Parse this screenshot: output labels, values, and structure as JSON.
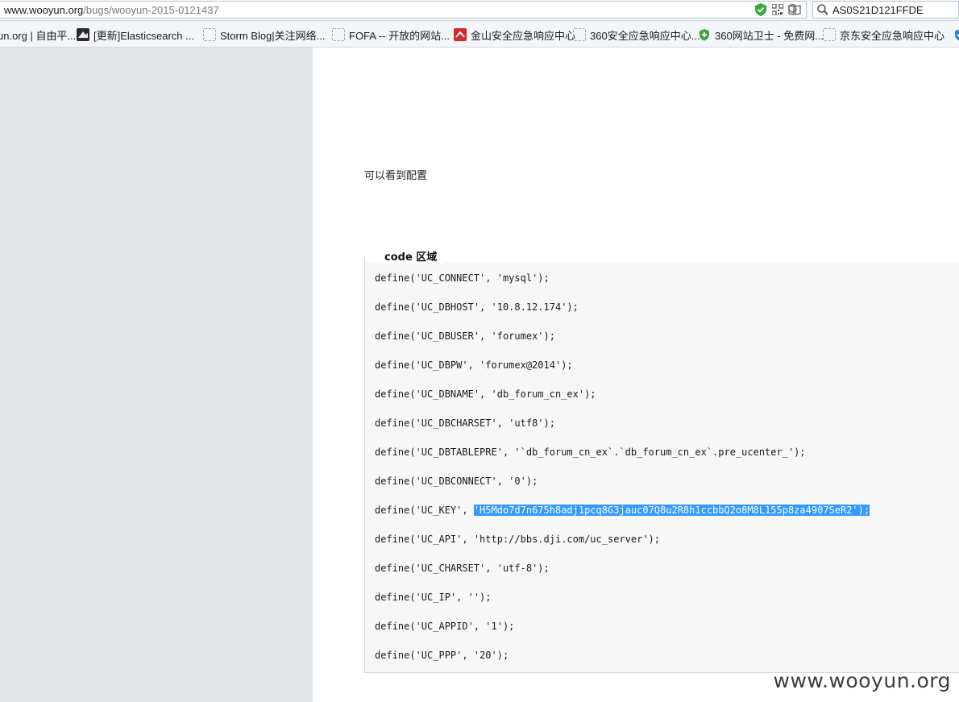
{
  "address_bar": {
    "url_domain": "www.wooyun.org",
    "url_path": "/bugs/wooyun-2015-0121437",
    "search_value": "AS0S21D121FFDE"
  },
  "icons": {
    "secure": "shield-check-icon",
    "qr": "qr-code-icon",
    "reader": "reader-mode-icon",
    "refresh": "refresh-icon",
    "search": "search-icon"
  },
  "bookmarks": [
    {
      "label": "un.org | 自由平...",
      "icon": "none"
    },
    {
      "label": "[更新]Elasticsearch ...",
      "icon": "dark"
    },
    {
      "label": "Storm Blog|关注网络...",
      "icon": "dotted"
    },
    {
      "label": "FOFA -- 开放的网站...",
      "icon": "dotted"
    },
    {
      "label": "金山安全应急响应中心",
      "icon": "red"
    },
    {
      "label": "360安全应急响应中心...",
      "icon": "dotted"
    },
    {
      "label": "360网站卫士 - 免费网...",
      "icon": "shield"
    },
    {
      "label": "京东安全应急响应中心",
      "icon": "dotted"
    }
  ],
  "content": {
    "description": "可以看到配置",
    "code_legend": "code 区域",
    "code_lines": [
      "define('UC_CONNECT', 'mysql');",
      "define('UC_DBHOST', '10.8.12.174');",
      "define('UC_DBUSER', 'forumex');",
      "define('UC_DBPW', 'forumex@2014');",
      "define('UC_DBNAME', 'db_forum_cn_ex');",
      "define('UC_DBCHARSET', 'utf8');",
      "define('UC_DBTABLEPRE', '`db_forum_cn_ex`.`db_forum_cn_ex`.pre_ucenter_');",
      "define('UC_DBCONNECT', '0');",
      "define('UC_KEY', ",
      "define('UC_API', 'http://bbs.dji.com/uc_server');",
      "define('UC_CHARSET', 'utf-8');",
      "define('UC_IP', '');",
      "define('UC_APPID', '1');",
      "define('UC_PPP', '20');"
    ],
    "uc_key_selected": "'H5Mdo7d7n675h8adj1pcq8G3jauc07Q8u2R8h1ccbbQ2o8M8L155p8za4907SeR2');"
  },
  "watermark": "www.wooyun.org",
  "colors": {
    "selection": "#3399ff",
    "sidebar": "#e1e4e7",
    "code_bg": "#f7f7f7"
  }
}
